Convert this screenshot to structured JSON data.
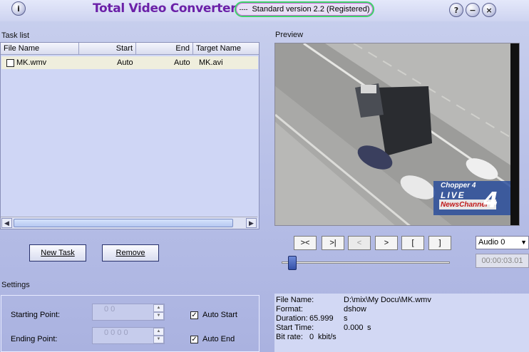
{
  "window": {
    "title": "Total Video Converter",
    "version": "Standard version 2.2 (Registered)",
    "version_dash": "----",
    "info_glyph": "i",
    "help_glyph": "?",
    "minimize_glyph": "−",
    "close_glyph": "×"
  },
  "tasklist": {
    "label": "Task list",
    "columns": [
      "File Name",
      "Start",
      "End",
      "Target Name"
    ],
    "rows": [
      {
        "file": "MK.wmv",
        "start": "Auto",
        "end": "Auto",
        "target": "MK.avi",
        "checked": false
      }
    ],
    "new_task": "New Task",
    "remove": "Remove"
  },
  "preview": {
    "label": "Preview",
    "overlay_top": "Chopper 4",
    "overlay_live": "LIVE",
    "overlay_channel": "NewsChannel",
    "overlay_num": "4"
  },
  "controls": {
    "buttons": [
      "><",
      ">|",
      "<",
      ">",
      "[",
      "]"
    ],
    "slider_position": 0.04,
    "audio": "Audio 0",
    "time": "00:00:03.01"
  },
  "info": {
    "file_name_label": "File Name:",
    "file_name": "D:\\mix\\My Docu\\MK.wmv",
    "format_label": "Format:",
    "format": "dshow",
    "duration_label": "Duration:",
    "duration": "65.999",
    "duration_unit": "s",
    "start_time_label": "Start Time:",
    "start_time": "0.000",
    "start_time_unit": "s",
    "bitrate_label": "Bit rate:",
    "bitrate": "0",
    "bitrate_unit": "kbit/s"
  },
  "settings": {
    "label": "Settings",
    "starting_point_label": "Starting Point:",
    "starting_point_value": "0    0",
    "ending_point_label": "Ending Point:",
    "ending_point_value": "0    0    0    0",
    "auto_start_label": "Auto Start",
    "auto_start_checked": true,
    "auto_end_label": "Auto End",
    "auto_end_checked": true,
    "check_glyph": "✓"
  },
  "colors": {
    "title": "#6b21a8",
    "pill_border": "#3ed36a",
    "background": "#b9c1e8"
  }
}
